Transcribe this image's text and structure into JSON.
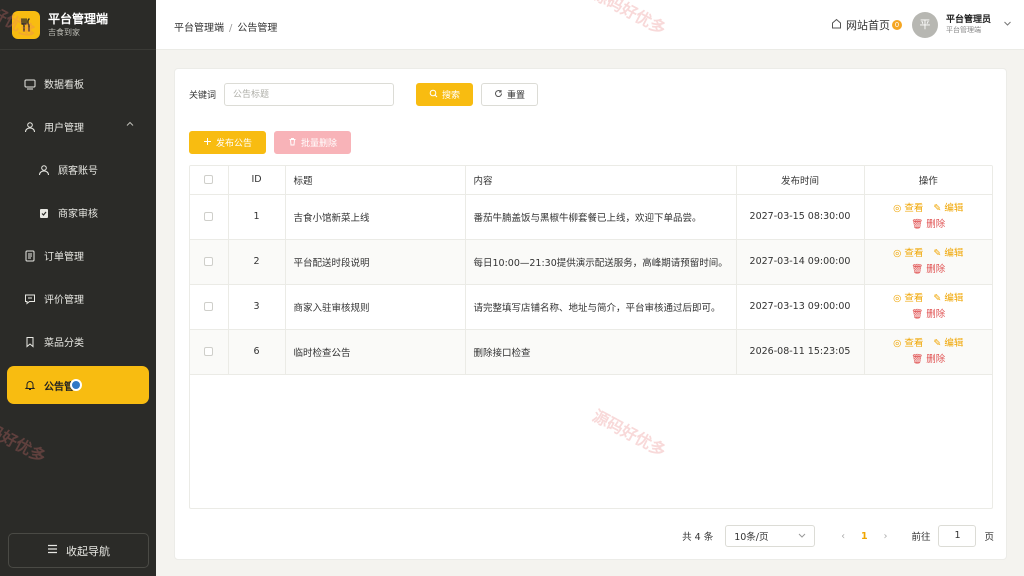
{
  "sidebar": {
    "brand_title": "平台管理端",
    "brand_sub": "吉食到家",
    "items": [
      {
        "label": "数据看板"
      },
      {
        "label": "用户管理"
      },
      {
        "label": "顾客账号"
      },
      {
        "label": "商家审核"
      },
      {
        "label": "订单管理"
      },
      {
        "label": "评价管理"
      },
      {
        "label": "菜品分类"
      },
      {
        "label": "公告管"
      }
    ],
    "collapse_label": "收起导航"
  },
  "header": {
    "breadcrumb": [
      "平台管理端",
      "公告管理"
    ],
    "breadcrumb_sep": "/",
    "site_home": "网站首页",
    "badge": "0",
    "avatar_char": "平",
    "user_name": "平台管理员",
    "user_role": "平台管理端"
  },
  "search": {
    "label": "关键词",
    "placeholder": "公告标题",
    "search_btn": "搜索",
    "reset_btn": "重置"
  },
  "actions": {
    "publish_btn": "发布公告",
    "batch_delete_btn": "批量删除"
  },
  "table": {
    "columns": [
      "ID",
      "标题",
      "内容",
      "发布时间",
      "操作"
    ],
    "rows": [
      {
        "id": "1",
        "title": "吉食小馆新菜上线",
        "content": "番茄牛腩盖饭与黑椒牛柳套餐已上线，欢迎下单品尝。",
        "time": "2027-03-15 08:30:00"
      },
      {
        "id": "2",
        "title": "平台配送时段说明",
        "content": "每日10:00—21:30提供演示配送服务，高峰期请预留时间。",
        "time": "2027-03-14 09:00:00"
      },
      {
        "id": "3",
        "title": "商家入驻审核规则",
        "content": "请完整填写店铺名称、地址与简介，平台审核通过后即可。",
        "time": "2027-03-13 09:00:00"
      },
      {
        "id": "6",
        "title": "临时检查公告",
        "content": "删除接口检查",
        "time": "2026-08-11 15:23:05"
      }
    ],
    "op_view": "查看",
    "op_edit": "编辑",
    "op_delete": "删除"
  },
  "pager": {
    "total": "共 4 条",
    "page_size": "10条/页",
    "current": "1",
    "goto_label": "前往",
    "goto_value": "1",
    "page_unit": "页"
  },
  "watermark": "源码好优多",
  "colors": {
    "accent": "#f8bc11",
    "sidebar_bg": "#2b2b28",
    "danger": "#e05050"
  }
}
